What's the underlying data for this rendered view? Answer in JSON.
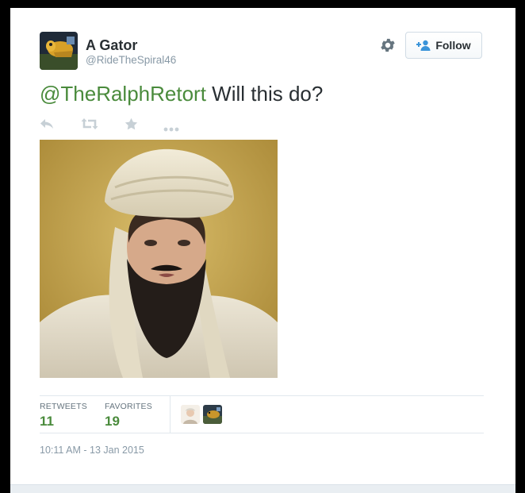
{
  "user": {
    "display_name": "A Gator",
    "handle": "@RideTheSpiral46"
  },
  "header": {
    "settings_icon": "gear-icon",
    "follow_label": "Follow"
  },
  "tweet": {
    "mention": "@TheRalphRetort",
    "text": " Will this do?"
  },
  "actions": [
    "reply-icon",
    "retweet-icon",
    "favorite-star-icon",
    "more-dots-icon"
  ],
  "stats": {
    "retweets_label": "RETWEETS",
    "retweets_value": "11",
    "favorites_label": "FAVORITES",
    "favorites_value": "19"
  },
  "timestamp": "10:11 AM - 13 Jan 2015",
  "colors": {
    "link_green": "#4a8b3c",
    "text": "#292f33",
    "muted": "#8899a6"
  }
}
